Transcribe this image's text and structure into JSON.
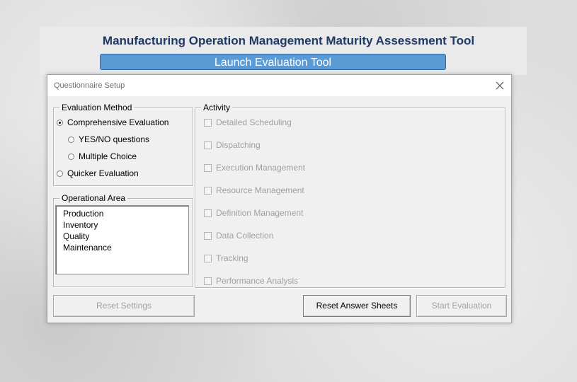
{
  "app_title": "Manufacturing Operation Management Maturity Assessment Tool",
  "launch_button_label": "Launch Evaluation Tool",
  "dialog": {
    "title": "Questionnaire Setup",
    "close_icon": "close-icon",
    "evaluation_method": {
      "label": "Evaluation Method",
      "options": [
        {
          "label": "Comprehensive Evaluation",
          "selected": true
        },
        {
          "label": "YES/NO questions",
          "selected": false
        },
        {
          "label": "Multiple Choice",
          "selected": false
        },
        {
          "label": "Quicker Evaluation",
          "selected": false
        }
      ]
    },
    "operational_area": {
      "label": "Operational Area",
      "items": [
        "Production",
        "Inventory",
        "Quality",
        "Maintenance"
      ]
    },
    "activity": {
      "label": "Activity",
      "items": [
        {
          "label": "Detailed Scheduling",
          "checked": false,
          "enabled": false
        },
        {
          "label": "Dispatching",
          "checked": false,
          "enabled": false
        },
        {
          "label": "Execution Management",
          "checked": false,
          "enabled": false
        },
        {
          "label": "Resource Management",
          "checked": false,
          "enabled": false
        },
        {
          "label": "Definition Management",
          "checked": false,
          "enabled": false
        },
        {
          "label": "Data Collection",
          "checked": false,
          "enabled": false
        },
        {
          "label": "Tracking",
          "checked": false,
          "enabled": false
        },
        {
          "label": "Performance Analysis",
          "checked": false,
          "enabled": false
        }
      ]
    },
    "buttons": {
      "reset_settings": "Reset Settings",
      "reset_answer_sheets": "Reset Answer Sheets",
      "start_evaluation": "Start Evaluation"
    }
  },
  "colors": {
    "title_text": "#1f3864",
    "launch_button": "#5b9bd5",
    "disabled_text": "#a0a0a0"
  }
}
